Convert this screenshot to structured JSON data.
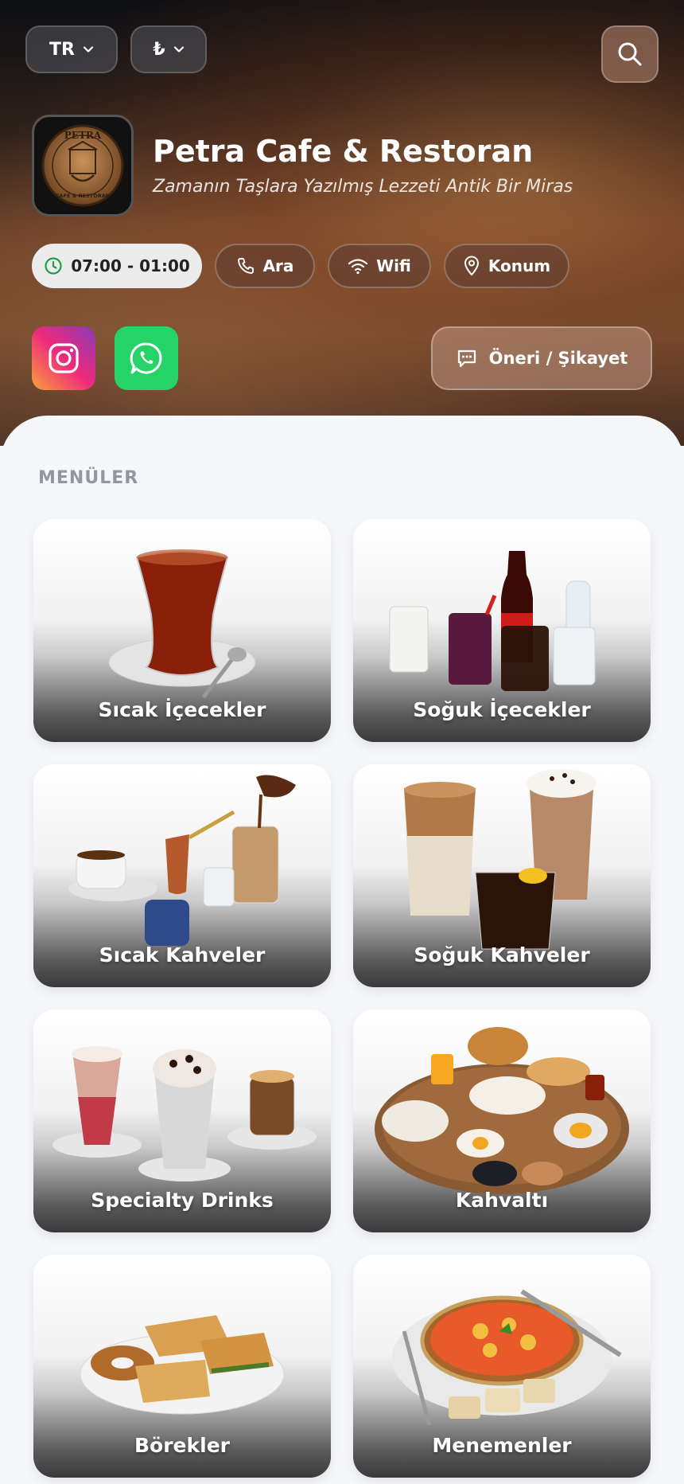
{
  "header": {
    "language": "TR",
    "currency": "₺",
    "search_icon": "search-icon"
  },
  "cafe": {
    "logo_text_top": "PETRA",
    "logo_text_bottom": "CAFE & RESTORAN",
    "name": "Petra Cafe & Restoran",
    "tagline": "Zamanın Taşlara Yazılmış Lezzeti Antik Bir Miras"
  },
  "info": {
    "hours": "07:00 - 01:00",
    "call": "Ara",
    "wifi": "Wifi",
    "location": "Konum"
  },
  "actions": {
    "feedback": "Öneri / Şikayet"
  },
  "colors": {
    "whatsapp": "#25d366",
    "hours_icon": "#1e9e4a",
    "section_title": "#9097a3"
  },
  "menus": {
    "title": "MENÜLER",
    "items": [
      {
        "label": "Sıcak İçecekler"
      },
      {
        "label": "Soğuk İçecekler"
      },
      {
        "label": "Sıcak Kahveler"
      },
      {
        "label": "Soğuk Kahveler"
      },
      {
        "label": "Specialty Drinks"
      },
      {
        "label": "Kahvaltı"
      },
      {
        "label": "Börekler"
      },
      {
        "label": "Menemenler"
      }
    ]
  }
}
